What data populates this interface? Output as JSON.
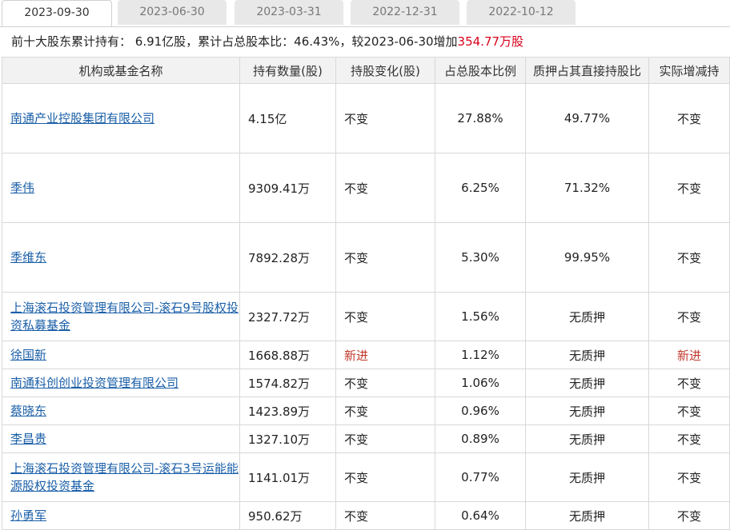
{
  "tabs": [
    "2023-09-30",
    "2023-06-30",
    "2023-03-31",
    "2022-12-31",
    "2022-10-12"
  ],
  "summary": {
    "prefix": "前十大股东累计持有：  6.91亿股，累计占总股本比：46.43%，较2023-06-30增加",
    "change": "354.77万股"
  },
  "columns": [
    "机构或基金名称",
    "持有数量(股)",
    "持股变化(股)",
    "占总股本比例",
    "质押占其直接持股比",
    "实际增减持"
  ],
  "rows": [
    {
      "name": "南通产业控股集团有限公司",
      "qty": "4.15亿",
      "change": "不变",
      "ratio": "27.88%",
      "pledge": "49.77%",
      "actual": "不变"
    },
    {
      "name": "季伟",
      "qty": "9309.41万",
      "change": "不变",
      "ratio": "6.25%",
      "pledge": "71.32%",
      "actual": "不变"
    },
    {
      "name": "季维东",
      "qty": "7892.28万",
      "change": "不变",
      "ratio": "5.30%",
      "pledge": "99.95%",
      "actual": "不变"
    },
    {
      "name": "上海滚石投资管理有限公司-滚石9号股权投资私募基金",
      "qty": "2327.72万",
      "change": "不变",
      "ratio": "1.56%",
      "pledge": "无质押",
      "actual": "不变"
    },
    {
      "name": "徐国新",
      "qty": "1668.88万",
      "change": "新进",
      "ratio": "1.12%",
      "pledge": "无质押",
      "actual": "新进"
    },
    {
      "name": "南通科创创业投资管理有限公司",
      "qty": "1574.82万",
      "change": "不变",
      "ratio": "1.06%",
      "pledge": "无质押",
      "actual": "不变"
    },
    {
      "name": "蔡晓东",
      "qty": "1423.89万",
      "change": "不变",
      "ratio": "0.96%",
      "pledge": "无质押",
      "actual": "不变"
    },
    {
      "name": "李昌贵",
      "qty": "1327.10万",
      "change": "不变",
      "ratio": "0.89%",
      "pledge": "无质押",
      "actual": "不变"
    },
    {
      "name": "上海滚石投资管理有限公司-滚石3号运能能源股权投资基金",
      "qty": "1141.01万",
      "change": "不变",
      "ratio": "0.77%",
      "pledge": "无质押",
      "actual": "不变"
    },
    {
      "name": "孙勇军",
      "qty": "950.62万",
      "change": "不变",
      "ratio": "0.64%",
      "pledge": "无质押",
      "actual": "不变"
    }
  ]
}
